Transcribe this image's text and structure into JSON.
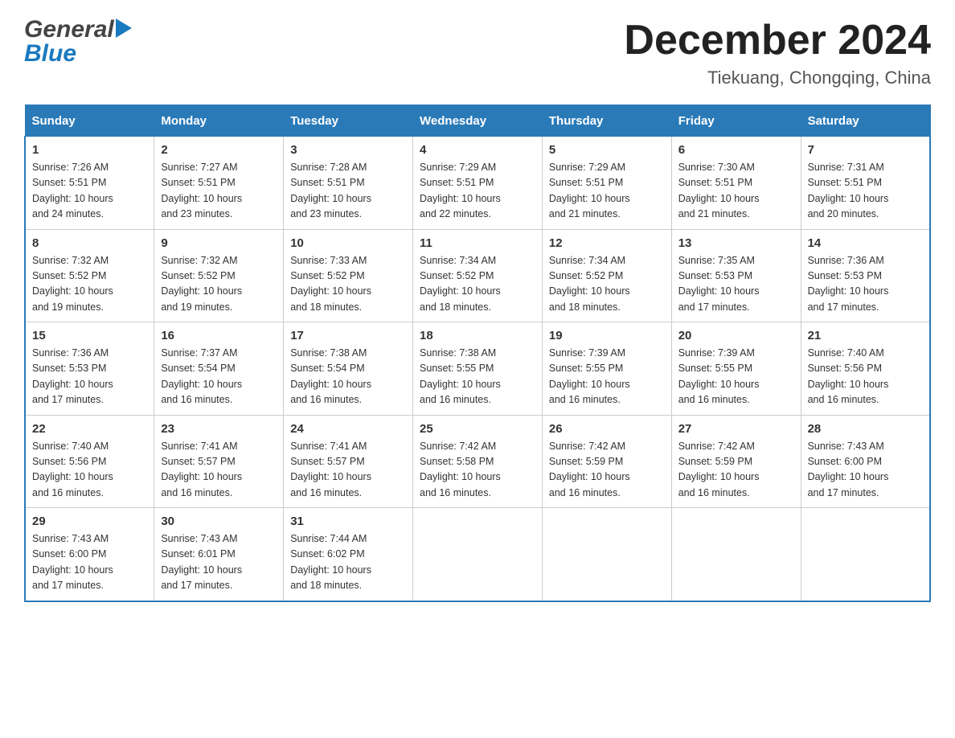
{
  "header": {
    "logo": {
      "general": "General",
      "blue": "Blue"
    },
    "title": "December 2024",
    "location": "Tiekuang, Chongqing, China"
  },
  "days": [
    "Sunday",
    "Monday",
    "Tuesday",
    "Wednesday",
    "Thursday",
    "Friday",
    "Saturday"
  ],
  "weeks": [
    [
      {
        "date": "1",
        "sunrise": "7:26 AM",
        "sunset": "5:51 PM",
        "daylight": "10 hours and 24 minutes."
      },
      {
        "date": "2",
        "sunrise": "7:27 AM",
        "sunset": "5:51 PM",
        "daylight": "10 hours and 23 minutes."
      },
      {
        "date": "3",
        "sunrise": "7:28 AM",
        "sunset": "5:51 PM",
        "daylight": "10 hours and 23 minutes."
      },
      {
        "date": "4",
        "sunrise": "7:29 AM",
        "sunset": "5:51 PM",
        "daylight": "10 hours and 22 minutes."
      },
      {
        "date": "5",
        "sunrise": "7:29 AM",
        "sunset": "5:51 PM",
        "daylight": "10 hours and 21 minutes."
      },
      {
        "date": "6",
        "sunrise": "7:30 AM",
        "sunset": "5:51 PM",
        "daylight": "10 hours and 21 minutes."
      },
      {
        "date": "7",
        "sunrise": "7:31 AM",
        "sunset": "5:51 PM",
        "daylight": "10 hours and 20 minutes."
      }
    ],
    [
      {
        "date": "8",
        "sunrise": "7:32 AM",
        "sunset": "5:52 PM",
        "daylight": "10 hours and 19 minutes."
      },
      {
        "date": "9",
        "sunrise": "7:32 AM",
        "sunset": "5:52 PM",
        "daylight": "10 hours and 19 minutes."
      },
      {
        "date": "10",
        "sunrise": "7:33 AM",
        "sunset": "5:52 PM",
        "daylight": "10 hours and 18 minutes."
      },
      {
        "date": "11",
        "sunrise": "7:34 AM",
        "sunset": "5:52 PM",
        "daylight": "10 hours and 18 minutes."
      },
      {
        "date": "12",
        "sunrise": "7:34 AM",
        "sunset": "5:52 PM",
        "daylight": "10 hours and 18 minutes."
      },
      {
        "date": "13",
        "sunrise": "7:35 AM",
        "sunset": "5:53 PM",
        "daylight": "10 hours and 17 minutes."
      },
      {
        "date": "14",
        "sunrise": "7:36 AM",
        "sunset": "5:53 PM",
        "daylight": "10 hours and 17 minutes."
      }
    ],
    [
      {
        "date": "15",
        "sunrise": "7:36 AM",
        "sunset": "5:53 PM",
        "daylight": "10 hours and 17 minutes."
      },
      {
        "date": "16",
        "sunrise": "7:37 AM",
        "sunset": "5:54 PM",
        "daylight": "10 hours and 16 minutes."
      },
      {
        "date": "17",
        "sunrise": "7:38 AM",
        "sunset": "5:54 PM",
        "daylight": "10 hours and 16 minutes."
      },
      {
        "date": "18",
        "sunrise": "7:38 AM",
        "sunset": "5:55 PM",
        "daylight": "10 hours and 16 minutes."
      },
      {
        "date": "19",
        "sunrise": "7:39 AM",
        "sunset": "5:55 PM",
        "daylight": "10 hours and 16 minutes."
      },
      {
        "date": "20",
        "sunrise": "7:39 AM",
        "sunset": "5:55 PM",
        "daylight": "10 hours and 16 minutes."
      },
      {
        "date": "21",
        "sunrise": "7:40 AM",
        "sunset": "5:56 PM",
        "daylight": "10 hours and 16 minutes."
      }
    ],
    [
      {
        "date": "22",
        "sunrise": "7:40 AM",
        "sunset": "5:56 PM",
        "daylight": "10 hours and 16 minutes."
      },
      {
        "date": "23",
        "sunrise": "7:41 AM",
        "sunset": "5:57 PM",
        "daylight": "10 hours and 16 minutes."
      },
      {
        "date": "24",
        "sunrise": "7:41 AM",
        "sunset": "5:57 PM",
        "daylight": "10 hours and 16 minutes."
      },
      {
        "date": "25",
        "sunrise": "7:42 AM",
        "sunset": "5:58 PM",
        "daylight": "10 hours and 16 minutes."
      },
      {
        "date": "26",
        "sunrise": "7:42 AM",
        "sunset": "5:59 PM",
        "daylight": "10 hours and 16 minutes."
      },
      {
        "date": "27",
        "sunrise": "7:42 AM",
        "sunset": "5:59 PM",
        "daylight": "10 hours and 16 minutes."
      },
      {
        "date": "28",
        "sunrise": "7:43 AM",
        "sunset": "6:00 PM",
        "daylight": "10 hours and 17 minutes."
      }
    ],
    [
      {
        "date": "29",
        "sunrise": "7:43 AM",
        "sunset": "6:00 PM",
        "daylight": "10 hours and 17 minutes."
      },
      {
        "date": "30",
        "sunrise": "7:43 AM",
        "sunset": "6:01 PM",
        "daylight": "10 hours and 17 minutes."
      },
      {
        "date": "31",
        "sunrise": "7:44 AM",
        "sunset": "6:02 PM",
        "daylight": "10 hours and 18 minutes."
      },
      null,
      null,
      null,
      null
    ]
  ]
}
